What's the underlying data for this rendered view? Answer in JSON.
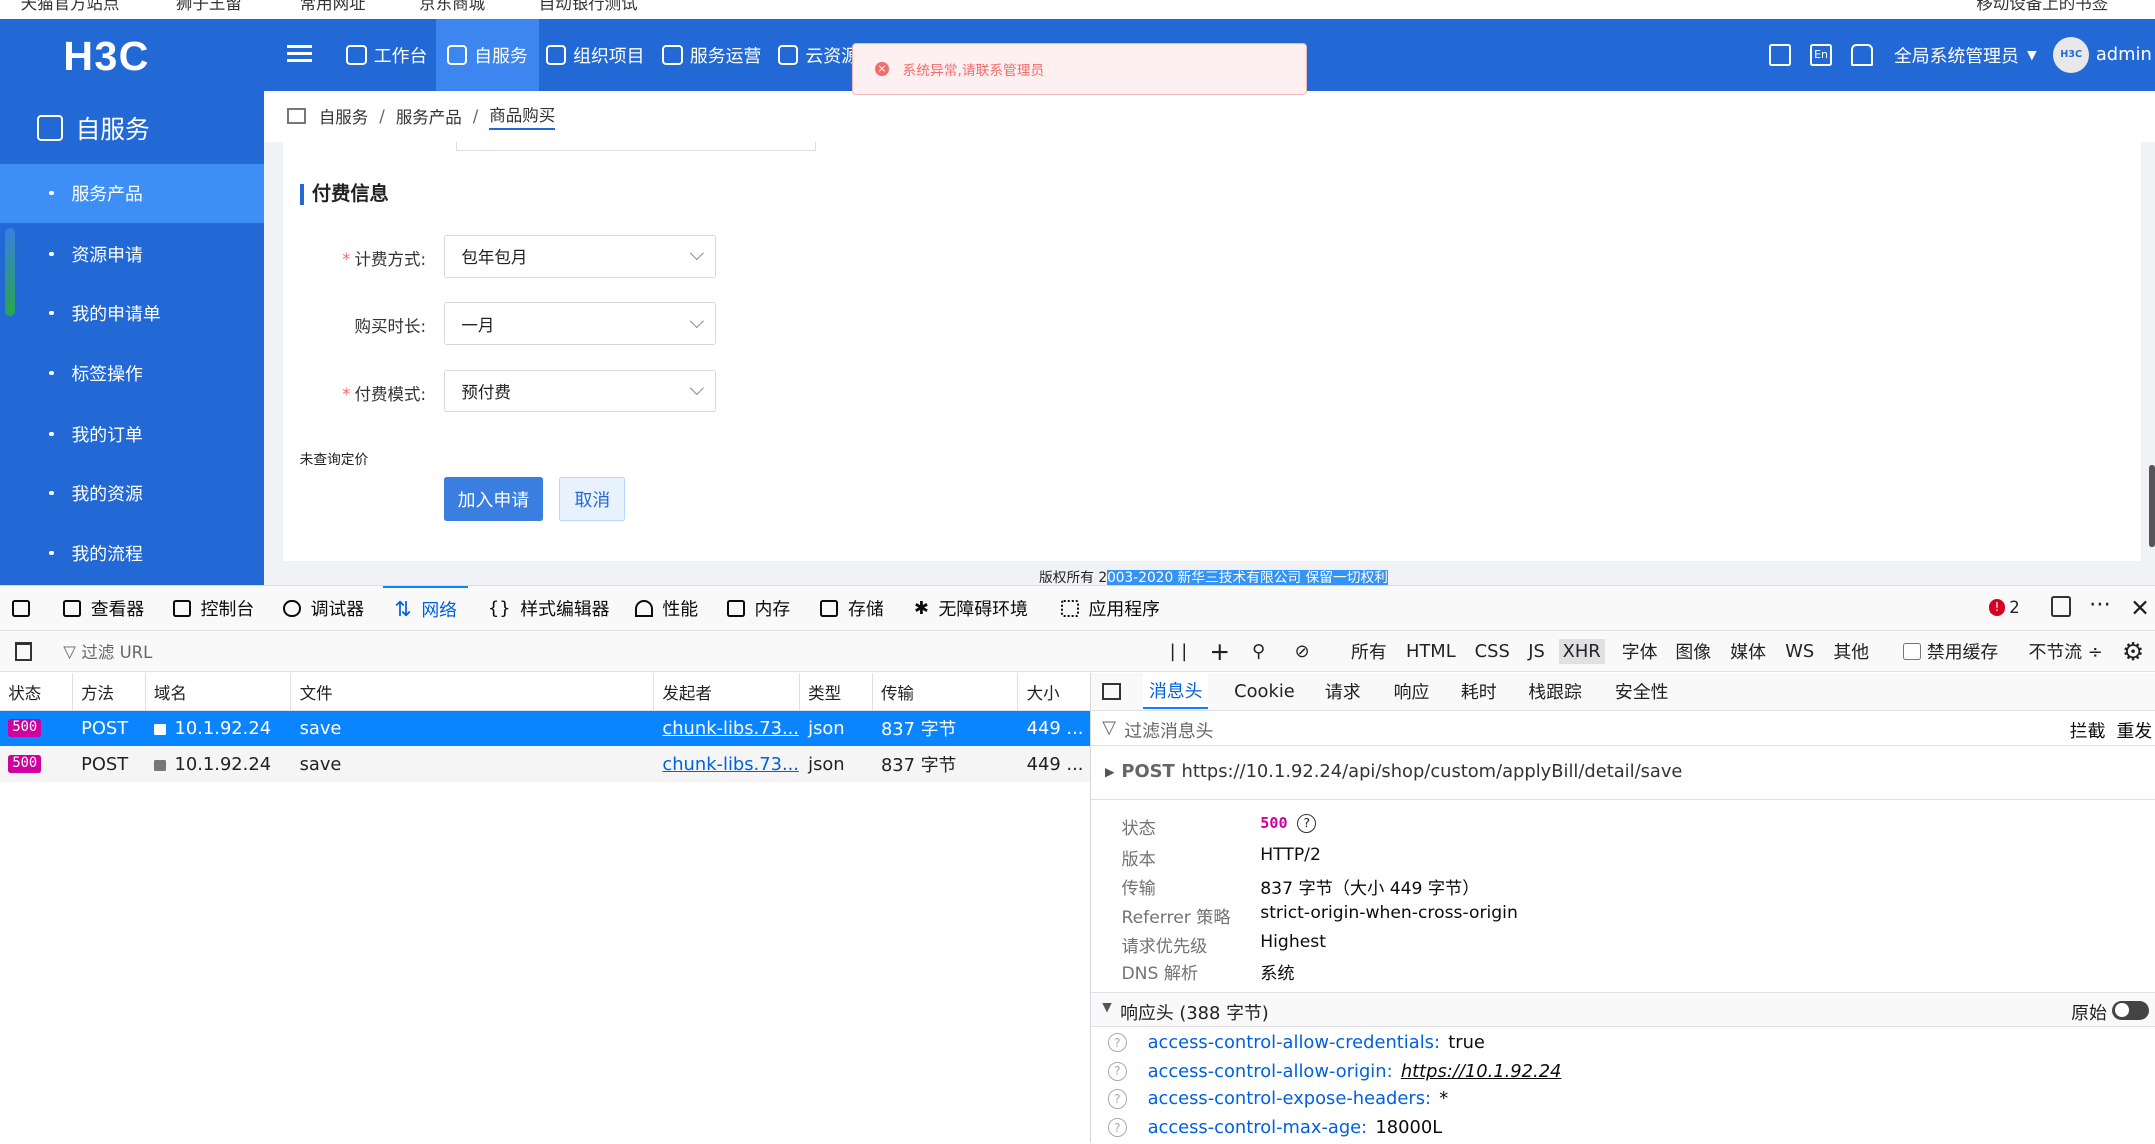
{
  "bookmarks": [
    "天猫官方站点",
    "狮子王留",
    "常用网址",
    "京东商城",
    "自动银行测试",
    "移动设备上的书签"
  ],
  "header": {
    "logo": "H3C",
    "nav": [
      "工作台",
      "自服务",
      "组织项目",
      "服务运营",
      "云资源"
    ],
    "role": "全局系统管理员",
    "user": "admin",
    "avatar": "H3C"
  },
  "toast": {
    "message": "系统异常,请联系管理员"
  },
  "sidebar": {
    "title": "自服务",
    "items": [
      "服务产品",
      "资源申请",
      "我的申请单",
      "标签操作",
      "我的订单",
      "我的资源",
      "我的流程"
    ]
  },
  "breadcrumb": [
    "自服务",
    "服务产品",
    "商品购买"
  ],
  "form": {
    "section": "付费信息",
    "billing_label": "计费方式:",
    "billing_value": "包年包月",
    "duration_label": "购买时长:",
    "duration_value": "一月",
    "pay_label": "付费模式:",
    "pay_value": "预付费",
    "note": "未查询定价",
    "submit": "加入申请",
    "cancel": "取消"
  },
  "footer": {
    "prefix": "版权所有 2",
    "highlighted": "003-2020 新华三技术有限公司 保留一切权利"
  },
  "devtools": {
    "tabs": [
      "查看器",
      "控制台",
      "调试器",
      "网络",
      "样式编辑器",
      "性能",
      "内存",
      "存储",
      "无障碍环境",
      "应用程序"
    ],
    "error_count": "2",
    "filter_placeholder": "过滤 URL",
    "type_filters": [
      "所有",
      "HTML",
      "CSS",
      "JS",
      "XHR",
      "字体",
      "图像",
      "媒体",
      "WS",
      "其他"
    ],
    "disable_cache": "禁用缓存",
    "throttle": "不节流 ÷",
    "pause": "| |",
    "columns": [
      "状态",
      "方法",
      "域名",
      "文件",
      "发起者",
      "类型",
      "传输",
      "大小"
    ],
    "requests": [
      {
        "status": "500",
        "method": "POST",
        "domain": "10.1.92.24",
        "file": "save",
        "initiator": "chunk-libs.73...",
        "type": "json",
        "transfer": "837 字节",
        "size": "449 ..."
      },
      {
        "status": "500",
        "method": "POST",
        "domain": "10.1.92.24",
        "file": "save",
        "initiator": "chunk-libs.73...",
        "type": "json",
        "transfer": "837 字节",
        "size": "449 ..."
      }
    ],
    "detail_tabs": [
      "消息头",
      "Cookie",
      "请求",
      "响应",
      "耗时",
      "栈跟踪",
      "安全性"
    ],
    "detail_filter": "过滤消息头",
    "block": "拦截",
    "resend": "重发",
    "request_method": "POST",
    "request_url": "https://10.1.92.24/api/shop/custom/applyBill/detail/save",
    "summary": [
      {
        "k": "状态",
        "v": "500"
      },
      {
        "k": "版本",
        "v": "HTTP/2"
      },
      {
        "k": "传输",
        "v": "837 字节（大小 449 字节）"
      },
      {
        "k": "Referrer 策略",
        "v": "strict-origin-when-cross-origin"
      },
      {
        "k": "请求优先级",
        "v": "Highest"
      },
      {
        "k": "DNS 解析",
        "v": "系统"
      }
    ],
    "response_headers_title": "响应头 (388 字节)",
    "raw_label": "原始",
    "response_headers": [
      {
        "k": "access-control-allow-credentials:",
        "v": "true"
      },
      {
        "k": "access-control-allow-origin:",
        "v": "https://10.1.92.24"
      },
      {
        "k": "access-control-expose-headers:",
        "v": "*"
      },
      {
        "k": "access-control-max-age:",
        "v": "18000L"
      }
    ]
  },
  "colors": {
    "brand": "#2369d6",
    "error": "#f56c6c",
    "devtools_accent": "#0a84ff",
    "status_500": "#d0009f"
  }
}
